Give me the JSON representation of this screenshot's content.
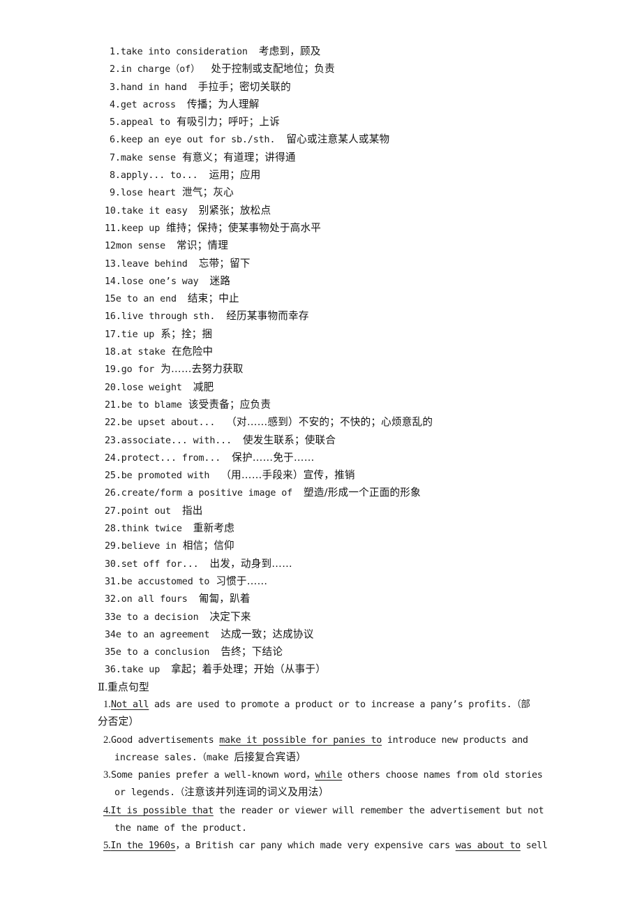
{
  "document": {
    "sections": [
      {
        "id": "phrases",
        "items": [
          {
            "num": "1.",
            "en": "take into consideration",
            "cn": "考虑到，顾及"
          },
          {
            "num": "2.",
            "en": "in charge（of）",
            "cn": "处于控制或支配地位；负责"
          },
          {
            "num": "3.",
            "en": "hand in hand",
            "cn": "手拉手；密切关联的"
          },
          {
            "num": "4.",
            "en": "get across",
            "cn": "传播；为人理解"
          },
          {
            "num": "5.",
            "en": "appeal to",
            "cn": "有吸引力；呼吁；上诉"
          },
          {
            "num": "6.",
            "en": "keep an eye out for sb./sth.",
            "cn": "留心或注意某人或某物"
          },
          {
            "num": "7.",
            "en": "make sense",
            "cn": "有意义；有道理；讲得通"
          },
          {
            "num": "8.",
            "en": "apply... to...",
            "cn": "运用；应用"
          },
          {
            "num": "9.",
            "en": "lose heart",
            "cn": "泄气；灰心"
          },
          {
            "num": "10.",
            "en": "take it easy",
            "cn": "别紧张；放松点"
          },
          {
            "num": "11.",
            "en": "keep up",
            "cn": "维持；保持；使某事物处于高水平"
          },
          {
            "num": "12",
            "en": "mon sense",
            "cn": "常识；情理"
          },
          {
            "num": "13.",
            "en": "leave behind",
            "cn": "忘带；留下"
          },
          {
            "num": "14.",
            "en": "lose one’s way",
            "cn": "迷路"
          },
          {
            "num": "15",
            "en": "e to an end",
            "cn": "结束；中止"
          },
          {
            "num": "16.",
            "en": "live through sth.",
            "cn": "经历某事物而幸存"
          },
          {
            "num": "17.",
            "en": "tie up",
            "cn": "系；拴；捆"
          },
          {
            "num": "18.",
            "en": "at stake",
            "cn": "在危险中"
          },
          {
            "num": "19.",
            "en": "go for",
            "cn": "为……去努力获取"
          },
          {
            "num": "20.",
            "en": "lose weight",
            "cn": "减肥"
          },
          {
            "num": "21.",
            "en": "be to blame",
            "cn": "该受责备；应负责"
          },
          {
            "num": "22.",
            "en": "be upset about...",
            "cn": "（对……感到）不安的；不快的；心烦意乱的"
          },
          {
            "num": "23.",
            "en": "associate... with...",
            "cn": "使发生联系；使联合"
          },
          {
            "num": "24.",
            "en": "protect... from...",
            "cn": "保护……免于……"
          },
          {
            "num": "25.",
            "en": "be promoted with",
            "cn": "（用……手段来）宣传，推销"
          },
          {
            "num": "26.",
            "en": "create/form a positive image of",
            "cn": "塑造/形成一个正面的形象"
          },
          {
            "num": "27.",
            "en": "point out",
            "cn": "指出"
          },
          {
            "num": "28.",
            "en": "think twice",
            "cn": "重新考虑"
          },
          {
            "num": "29.",
            "en": "believe in",
            "cn": "相信；信仰"
          },
          {
            "num": "30.",
            "en": "set off for...",
            "cn": "出发，动身到……"
          },
          {
            "num": "31.",
            "en": "be accustomed to",
            "cn": "习惯于……"
          },
          {
            "num": "32.",
            "en": "on all fours",
            "cn": "匍匐，趴着"
          },
          {
            "num": "33",
            "en": "e to a decision",
            "cn": "决定下来"
          },
          {
            "num": "34",
            "en": "e to an agreement",
            "cn": "达成一致；达成协议"
          },
          {
            "num": "35",
            "en": "e to a conclusion",
            "cn": "告终；下结论"
          },
          {
            "num": "36.",
            "en": "take up",
            "cn": "拿起；着手处理；开始（从事于）"
          }
        ]
      },
      {
        "id": "sentence-patterns",
        "heading": {
          "numeral": "Ⅱ.",
          "title": "重点句型"
        },
        "items": [
          {
            "num": "1.",
            "line1_a": "Not all",
            "line1_b": " ads are used to promote a product or to increase a pany’s profits.（部",
            "line2": "分否定）"
          },
          {
            "num": "2.",
            "line1_a": "Good advertisements ",
            "line1_u": "make it possible for panies to",
            "line1_b": " introduce new products and",
            "line2_a": "increase sales.（make ",
            "line2_cn": "后接复合宾语",
            "line2_b": "）"
          },
          {
            "num": "3.",
            "line1_a": "Some panies prefer a well-known word，",
            "line1_u": "while",
            "line1_b": " others choose names from old stories",
            "line2_a": "or legends.（",
            "line2_cn": "注意该并列连词的词义及用法",
            "line2_b": "）"
          },
          {
            "num": "4.",
            "line1_u": "It is possible that",
            "line1_b": " the reader or viewer will remember the advertisement but not",
            "line2": "the name of the product."
          },
          {
            "num": "5.",
            "line1_u1": "In the 1960s",
            "line1_m": "，a British car pany which made very expensive cars ",
            "line1_u2": "was about to",
            "line1_end": " sell"
          }
        ]
      }
    ]
  }
}
